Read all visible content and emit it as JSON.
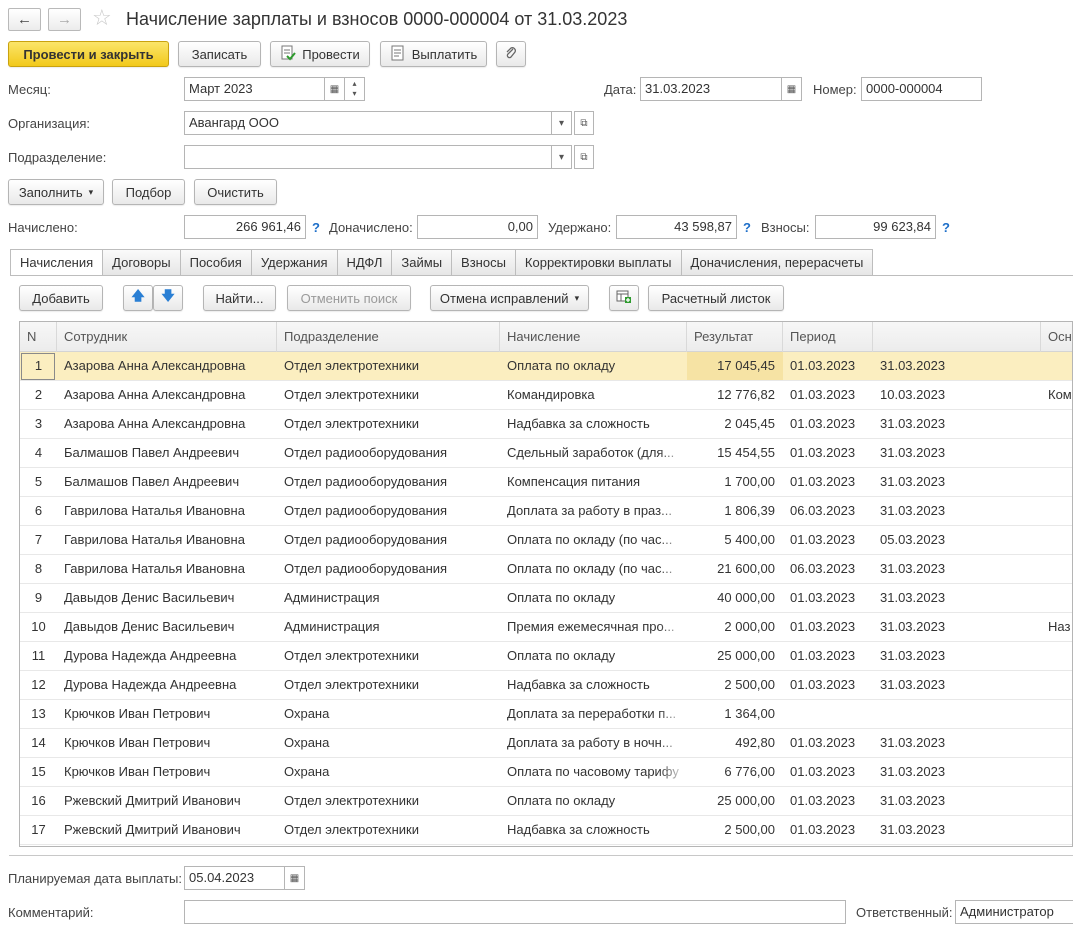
{
  "window": {
    "title": "Начисление зарплаты и взносов 0000-000004 от 31.03.2023"
  },
  "toolbar": {
    "post_close": "Провести и закрыть",
    "save": "Записать",
    "post": "Провести",
    "pay": "Выплатить"
  },
  "header": {
    "month_label": "Месяц:",
    "month_value": "Март 2023",
    "date_label": "Дата:",
    "date_value": "31.03.2023",
    "number_label": "Номер:",
    "number_value": "0000-000004",
    "org_label": "Организация:",
    "org_value": "Авангард ООО",
    "dept_label": "Подразделение:",
    "dept_value": ""
  },
  "actions": {
    "fill": "Заполнить",
    "pick": "Подбор",
    "clear": "Очистить"
  },
  "totals": {
    "accrued_label": "Начислено:",
    "accrued_value": "266 961,46",
    "extra_label": "Доначислено:",
    "extra_value": "0,00",
    "withheld_label": "Удержано:",
    "withheld_value": "43 598,87",
    "contrib_label": "Взносы:",
    "contrib_value": "99 623,84",
    "help": "?"
  },
  "tabs": [
    "Начисления",
    "Договоры",
    "Пособия",
    "Удержания",
    "НДФЛ",
    "Займы",
    "Взносы",
    "Корректировки выплаты",
    "Доначисления, перерасчеты"
  ],
  "table_toolbar": {
    "add": "Добавить",
    "find": "Найти...",
    "cancel_search": "Отменить поиск",
    "cancel_fix": "Отмена исправлений",
    "payslip": "Расчетный листок"
  },
  "table": {
    "columns": [
      "N",
      "Сотрудник",
      "Подразделение",
      "Начисление",
      "Результат",
      "Период",
      "",
      "Осн"
    ],
    "rows": [
      [
        "1",
        "Азарова Анна Александровна",
        "Отдел электротехники",
        "Оплата по окладу",
        "17 045,45",
        "01.03.2023",
        "31.03.2023",
        ""
      ],
      [
        "2",
        "Азарова Анна Александровна",
        "Отдел электротехники",
        "Командировка",
        "12 776,82",
        "01.03.2023",
        "10.03.2023",
        "Ком"
      ],
      [
        "3",
        "Азарова Анна Александровна",
        "Отдел электротехники",
        "Надбавка за сложность",
        "2 045,45",
        "01.03.2023",
        "31.03.2023",
        ""
      ],
      [
        "4",
        "Балмашов Павел Андреевич",
        "Отдел радиооборудования",
        "Сдельный заработок (для...",
        "15 454,55",
        "01.03.2023",
        "31.03.2023",
        ""
      ],
      [
        "5",
        "Балмашов Павел Андреевич",
        "Отдел радиооборудования",
        "Компенсация питания",
        "1 700,00",
        "01.03.2023",
        "31.03.2023",
        ""
      ],
      [
        "6",
        "Гаврилова Наталья Ивановна",
        "Отдел радиооборудования",
        "Доплата за работу в праз...",
        "1 806,39",
        "06.03.2023",
        "31.03.2023",
        ""
      ],
      [
        "7",
        "Гаврилова Наталья Ивановна",
        "Отдел радиооборудования",
        "Оплата по окладу (по час...",
        "5 400,00",
        "01.03.2023",
        "05.03.2023",
        ""
      ],
      [
        "8",
        "Гаврилова Наталья Ивановна",
        "Отдел радиооборудования",
        "Оплата по окладу (по час...",
        "21 600,00",
        "06.03.2023",
        "31.03.2023",
        ""
      ],
      [
        "9",
        "Давыдов Денис Васильевич",
        "Администрация",
        "Оплата по окладу",
        "40 000,00",
        "01.03.2023",
        "31.03.2023",
        ""
      ],
      [
        "10",
        "Давыдов Денис Васильевич",
        "Администрация",
        "Премия ежемесячная про...",
        "2 000,00",
        "01.03.2023",
        "31.03.2023",
        "Наз"
      ],
      [
        "11",
        "Дурова Надежда Андреевна",
        "Отдел электротехники",
        "Оплата по окладу",
        "25 000,00",
        "01.03.2023",
        "31.03.2023",
        ""
      ],
      [
        "12",
        "Дурова Надежда Андреевна",
        "Отдел электротехники",
        "Надбавка за сложность",
        "2 500,00",
        "01.03.2023",
        "31.03.2023",
        ""
      ],
      [
        "13",
        "Крючков Иван Петрович",
        "Охрана",
        "Доплата за переработки п...",
        "1 364,00",
        "",
        "",
        ""
      ],
      [
        "14",
        "Крючков Иван Петрович",
        "Охрана",
        "Доплата за работу в ночн...",
        "492,80",
        "01.03.2023",
        "31.03.2023",
        ""
      ],
      [
        "15",
        "Крючков Иван Петрович",
        "Охрана",
        "Оплата по часовому тарифу",
        "6 776,00",
        "01.03.2023",
        "31.03.2023",
        ""
      ],
      [
        "16",
        "Ржевский Дмитрий Иванович",
        "Отдел электротехники",
        "Оплата по окладу",
        "25 000,00",
        "01.03.2023",
        "31.03.2023",
        ""
      ],
      [
        "17",
        "Ржевский Дмитрий Иванович",
        "Отдел электротехники",
        "Надбавка за сложность",
        "2 500,00",
        "01.03.2023",
        "31.03.2023",
        ""
      ]
    ]
  },
  "footer": {
    "pay_date_label": "Планируемая дата выплаты:",
    "pay_date_value": "05.04.2023",
    "comment_label": "Комментарий:",
    "comment_value": "",
    "responsible_label": "Ответственный:",
    "responsible_value": "Администратор"
  }
}
